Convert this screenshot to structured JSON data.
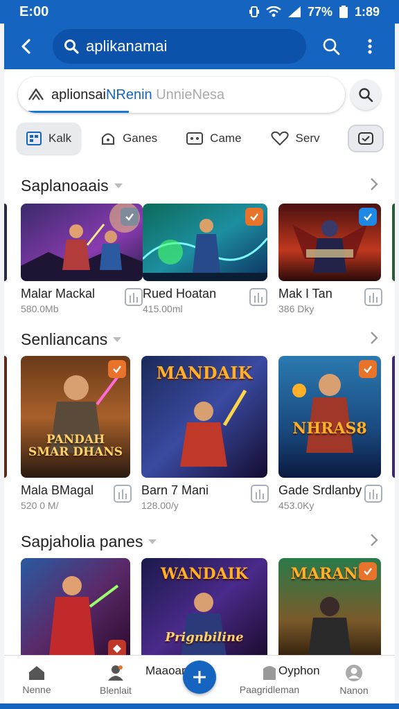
{
  "status": {
    "time": "E:00",
    "battery": "77%",
    "clock": "1:89"
  },
  "appbar": {
    "search_text": "aplikanamai"
  },
  "search": {
    "text_dark": "aplionsai",
    "text_blue": "NRenin",
    "text_light": "UnnieNesa"
  },
  "chips": [
    {
      "label": "Kalk",
      "icon": "grid-icon"
    },
    {
      "label": "Ganes",
      "icon": "controller-icon"
    },
    {
      "label": "Came",
      "icon": "gamepad-icon"
    },
    {
      "label": "Serv",
      "icon": "heart-icon"
    }
  ],
  "sections": [
    {
      "title": "Saplanoaais",
      "items": [
        {
          "title": "Malar Mackal",
          "sub": "580.0Mb"
        },
        {
          "title": "Rued Hoatan",
          "sub": "415.00ml"
        },
        {
          "title": "Mak I Tan",
          "sub": "386 Dky"
        }
      ]
    },
    {
      "title": "Senliancans",
      "items": [
        {
          "title": "Mala BMagal",
          "sub": "520 0 M/",
          "art": "PANDAH SMAR DHANS"
        },
        {
          "title": "Barn 7 Mani",
          "sub": "128.00/y",
          "art": "MANDAIK"
        },
        {
          "title": "Gade Srdlanby",
          "sub": "453.0Ky",
          "art": "NHRAS8"
        }
      ]
    },
    {
      "title": "Sapjaholia panes",
      "items": [
        {
          "title": "",
          "sub": ""
        },
        {
          "title": "",
          "sub": "",
          "art": "WANDAIK",
          "art2": "Prignbiline"
        },
        {
          "title": "",
          "sub": "",
          "art": "MARANS"
        }
      ]
    }
  ],
  "nav": [
    {
      "label": "Nenne",
      "icon": "home-icon"
    },
    {
      "label": "Blenlait",
      "icon": "person-icon",
      "top": "Maaoar"
    },
    {
      "label": "Paagridleman",
      "icon": "paper-icon",
      "top": "Oyphon"
    },
    {
      "label": "Nanon",
      "icon": "account-icon"
    }
  ],
  "colors": {
    "primary": "#1565c0",
    "accent_orange": "#e8742c",
    "accent_blue": "#1e88e5"
  }
}
